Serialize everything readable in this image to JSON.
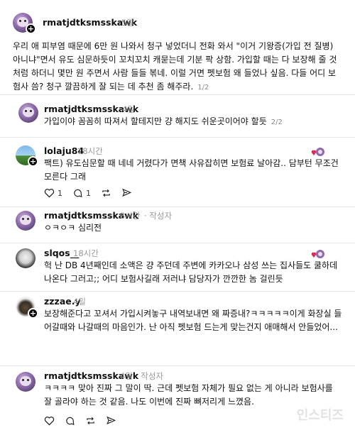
{
  "post": {
    "username": "rmatjdtksmsskawk",
    "time": "5일",
    "text": "우리 애 피부염 때문에 6만 원 나와서 청구 넣었더니 전화 와서 \"이거 기왕증(가입 전 질병) 아니냐\"면서 유도 심문하듯이 꼬치꼬치 캐묻는데 기분 팍 상함. 가입할 때는 다 보장해 줄 것처럼 하더니 몇만 원 주면서 사람 들들 볶네. 이럴 거면 펫보험 왜 들었나 싶음. 다들 어디 보험사 씀? 청구 깔끔하게 잘 되는 데 추천 좀 해주라.",
    "pager": "1/2"
  },
  "post2": {
    "username": "rmatjdtksmsskawk",
    "time": "4일",
    "text": "가입이야 꼼꼼히 따져서 할테지만 걍 해지도 쉬운곳이어야 할듯",
    "pager": "2/2"
  },
  "replies": [
    {
      "username": "lolaju84",
      "time": "18시간",
      "text": "팩트) 유도심문할 때 네네 거렸다가 면책 사유잡히면 보험료 날아감.. 담부턴 무조건 모른다 그래",
      "likes": "1",
      "comments": "1"
    },
    {
      "username": "rmatjdtksmsskawk",
      "time": "3시간",
      "author_tag": "· 작성자",
      "text": "ㅇㅋㅇㅋ 심리전"
    },
    {
      "username": "slqos__",
      "time": "18시간",
      "text": "헉 난 DB 4년째인데 소액은 걍 주던데 주변에 카카오나 삼성 쓰는 집사들도 쿨하데 나온다 그러고;; 어디 보험사길래 저러냐 담당자가 깐깐한 놈 걸린듯"
    },
    {
      "username": "zzzae.y",
      "time": "4일",
      "text": "보장해준다고 꼬셔서 가입시켜놓구 내역보내면 왜 짜증내?ㅋㅋㅋㅋㅋ이게 화장실 들어갈때와 나갈때의 마음인가. 난 아직 펫보험 드는게 맞는건지 애매해서 안들었어..."
    },
    {
      "username": "rmatjdtksmsskawk",
      "time": "4일",
      "author_tag": "· 작성자",
      "text": "ㅋㅋㅋㅋ 맞아 진짜 그 말이 딱. 근데 펫보험 자체가 필요 없는 게 아니라 보험사를 잘 골라야 하는 것 같음. 나도 이번에 진짜 뼈저리게 느꼈음."
    }
  ],
  "watermark": "인스티즈",
  "colors": {
    "like_heart": "#e0245e",
    "muted": "#999999",
    "divider": "#e6e6e6"
  }
}
